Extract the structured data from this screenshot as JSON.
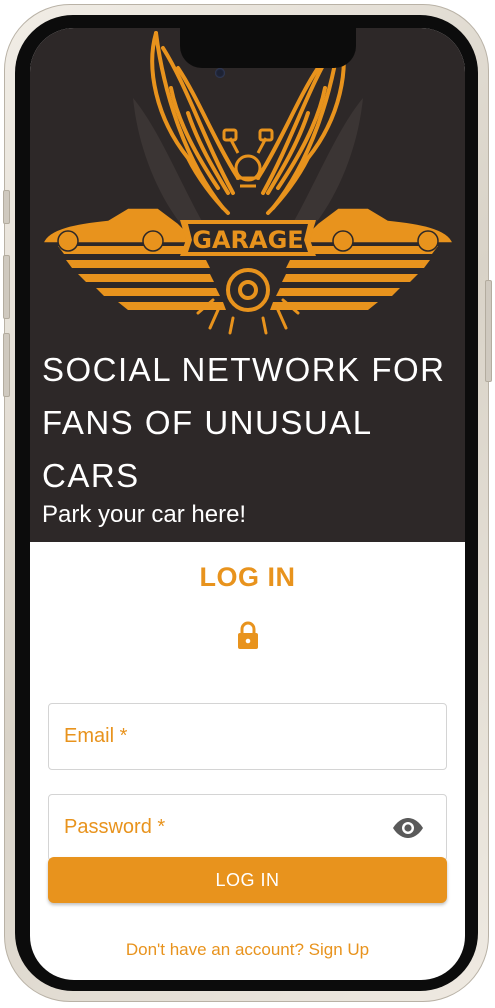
{
  "hero": {
    "logo_text": "GARAGE",
    "headline": "SOCIAL NETWORK FOR FANS OF UNUSUAL CARS",
    "tagline": "Park your car here!"
  },
  "login": {
    "title": "LOG IN",
    "email_label": "Email *",
    "password_label": "Password *",
    "submit_label": "LOG IN",
    "signup_link": "Don't have an account? Sign Up"
  },
  "colors": {
    "accent": "#e8931d",
    "hero_bg": "#2d2828",
    "field_border": "#d4d4d4"
  },
  "icons": [
    "lock-icon",
    "visibility-eye-icon",
    "camera-icon"
  ]
}
